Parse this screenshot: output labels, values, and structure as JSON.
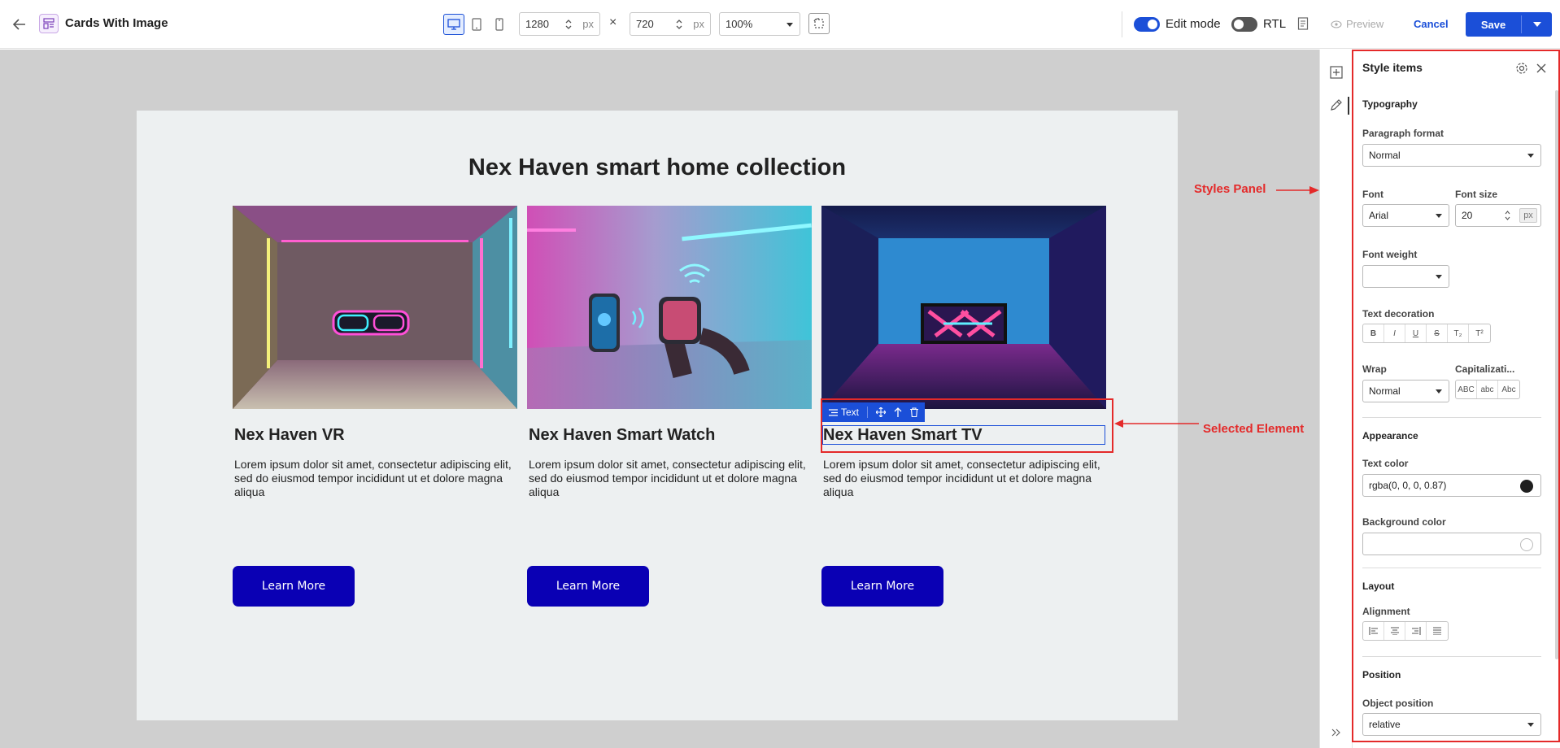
{
  "topbar": {
    "title": "Cards With Image",
    "width_value": "1280",
    "height_value": "720",
    "unit": "px",
    "times": "×",
    "zoom": "100%",
    "edit_mode_label": "Edit mode",
    "rtl_label": "RTL",
    "preview_label": "Preview",
    "cancel_label": "Cancel",
    "save_label": "Save",
    "edit_mode_on": true,
    "rtl_on": false
  },
  "page": {
    "heading": "Nex Haven smart home collection",
    "cards": [
      {
        "title": "Nex Haven VR",
        "body": "Lorem ipsum dolor sit amet, consectetur adipiscing elit, sed do eiusmod tempor incididunt ut et dolore magna aliqua",
        "button": "Learn More",
        "image": "vr-headset-neon-room"
      },
      {
        "title": "Nex Haven Smart Watch",
        "body": "Lorem ipsum dolor sit amet, consectetur adipiscing elit, sed do eiusmod tempor incididunt ut et dolore magna aliqua",
        "button": "Learn More",
        "image": "phone-and-smartwatch-neon"
      },
      {
        "title": "Nex Haven Smart TV",
        "body": "Lorem ipsum dolor sit amet, consectetur adipiscing elit, sed do eiusmod tempor incididunt ut et dolore magna aliqua",
        "button": "Learn More",
        "image": "tv-neon-room"
      }
    ],
    "selected_toolbar_label": "Text"
  },
  "annotations": {
    "styles_panel": "Styles Panel",
    "selected_element": "Selected Element"
  },
  "panel": {
    "title": "Style items",
    "typography": "Typography",
    "paragraph_format_label": "Paragraph format",
    "paragraph_format_value": "Normal",
    "font_label": "Font",
    "font_value": "Arial",
    "font_size_label": "Font size",
    "font_size_value": "20",
    "font_size_unit": "px",
    "font_weight_label": "Font weight",
    "font_weight_value": "",
    "text_decoration_label": "Text decoration",
    "decorations": [
      "B",
      "I",
      "U",
      "S",
      "T₂",
      "T²"
    ],
    "wrap_label": "Wrap",
    "wrap_value": "Normal",
    "capitalization_label": "Capitalizati...",
    "capitalization_options": [
      "ABC",
      "abc",
      "Abc"
    ],
    "appearance": "Appearance",
    "text_color_label": "Text color",
    "text_color_value": "rgba(0, 0, 0, 0.87)",
    "background_color_label": "Background color",
    "background_color_value": "",
    "layout": "Layout",
    "alignment_label": "Alignment",
    "position": "Position",
    "object_position_label": "Object position",
    "object_position_value": "relative"
  },
  "colors": {
    "primary": "#1b4fd8",
    "learn_button": "#0a00b4",
    "annotation_red": "#e42a2a",
    "canvas_bg": "#cfcfcf",
    "frame_bg": "#edf0f1",
    "text_color_swatch": "#1f1f1f"
  }
}
